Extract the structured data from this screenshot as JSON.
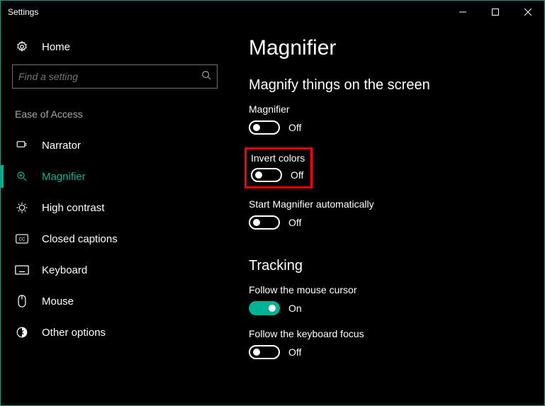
{
  "window": {
    "title": "Settings"
  },
  "sidebar": {
    "home_label": "Home",
    "search_placeholder": "Find a setting",
    "category": "Ease of Access",
    "items": [
      {
        "label": "Narrator"
      },
      {
        "label": "Magnifier"
      },
      {
        "label": "High contrast"
      },
      {
        "label": "Closed captions"
      },
      {
        "label": "Keyboard"
      },
      {
        "label": "Mouse"
      },
      {
        "label": "Other options"
      }
    ]
  },
  "main": {
    "title": "Magnifier",
    "section1": "Magnify things on the screen",
    "magnifier_label": "Magnifier",
    "magnifier_state": "Off",
    "invert_label": "Invert colors",
    "invert_state": "Off",
    "auto_label": "Start Magnifier automatically",
    "auto_state": "Off",
    "section2": "Tracking",
    "follow_mouse_label": "Follow the mouse cursor",
    "follow_mouse_state": "On",
    "follow_keyboard_label": "Follow the keyboard focus",
    "follow_keyboard_state": "Off"
  },
  "colors": {
    "accent": "#00b294",
    "highlight": "#ff0000"
  }
}
